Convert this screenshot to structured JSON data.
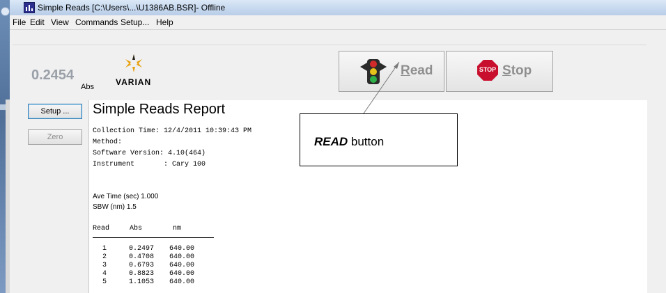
{
  "window": {
    "title": "Simple Reads [C:\\Users\\...\\U1386AB.BSR]- Offline"
  },
  "menu": [
    "File",
    "Edit",
    "View",
    "Commands",
    "Setup...",
    "Help"
  ],
  "toolbar": {
    "abs_value": "0.2454",
    "abs_unit": "Abs",
    "logo_text": "VARIAN",
    "read_button": {
      "underlined": "R",
      "rest": "ead"
    },
    "stop_button": {
      "underlined": "S",
      "rest": "top",
      "sign_text": "STOP"
    }
  },
  "side_buttons": {
    "setup": "Setup ...",
    "zero": "Zero"
  },
  "report": {
    "title": "Simple Reads Report",
    "header_lines": [
      "Collection Time: 12/4/2011 10:39:43 PM",
      "Method:",
      "Software Version: 4.10(464)",
      "Instrument       : Cary 100"
    ],
    "ave_time": "Ave Time (sec)  1.000",
    "sbw": "SBW (nm) 1.5",
    "columns": [
      "Read",
      "Abs",
      "nm"
    ],
    "rows": [
      {
        "read": "1",
        "abs": "0.2497",
        "nm": "640.00"
      },
      {
        "read": "2",
        "abs": "0.4708",
        "nm": "640.00"
      },
      {
        "read": "3",
        "abs": "0.6793",
        "nm": "640.00"
      },
      {
        "read": "4",
        "abs": "0.8823",
        "nm": "640.00"
      },
      {
        "read": "5",
        "abs": "1.1053",
        "nm": "640.00"
      }
    ]
  },
  "annotation": {
    "bold_text": "READ",
    "rest_text": " button"
  },
  "colors": {
    "title_bar": "#c7d9ef",
    "stop_red": "#c8102e",
    "disabled_text": "#8f8f8f"
  }
}
